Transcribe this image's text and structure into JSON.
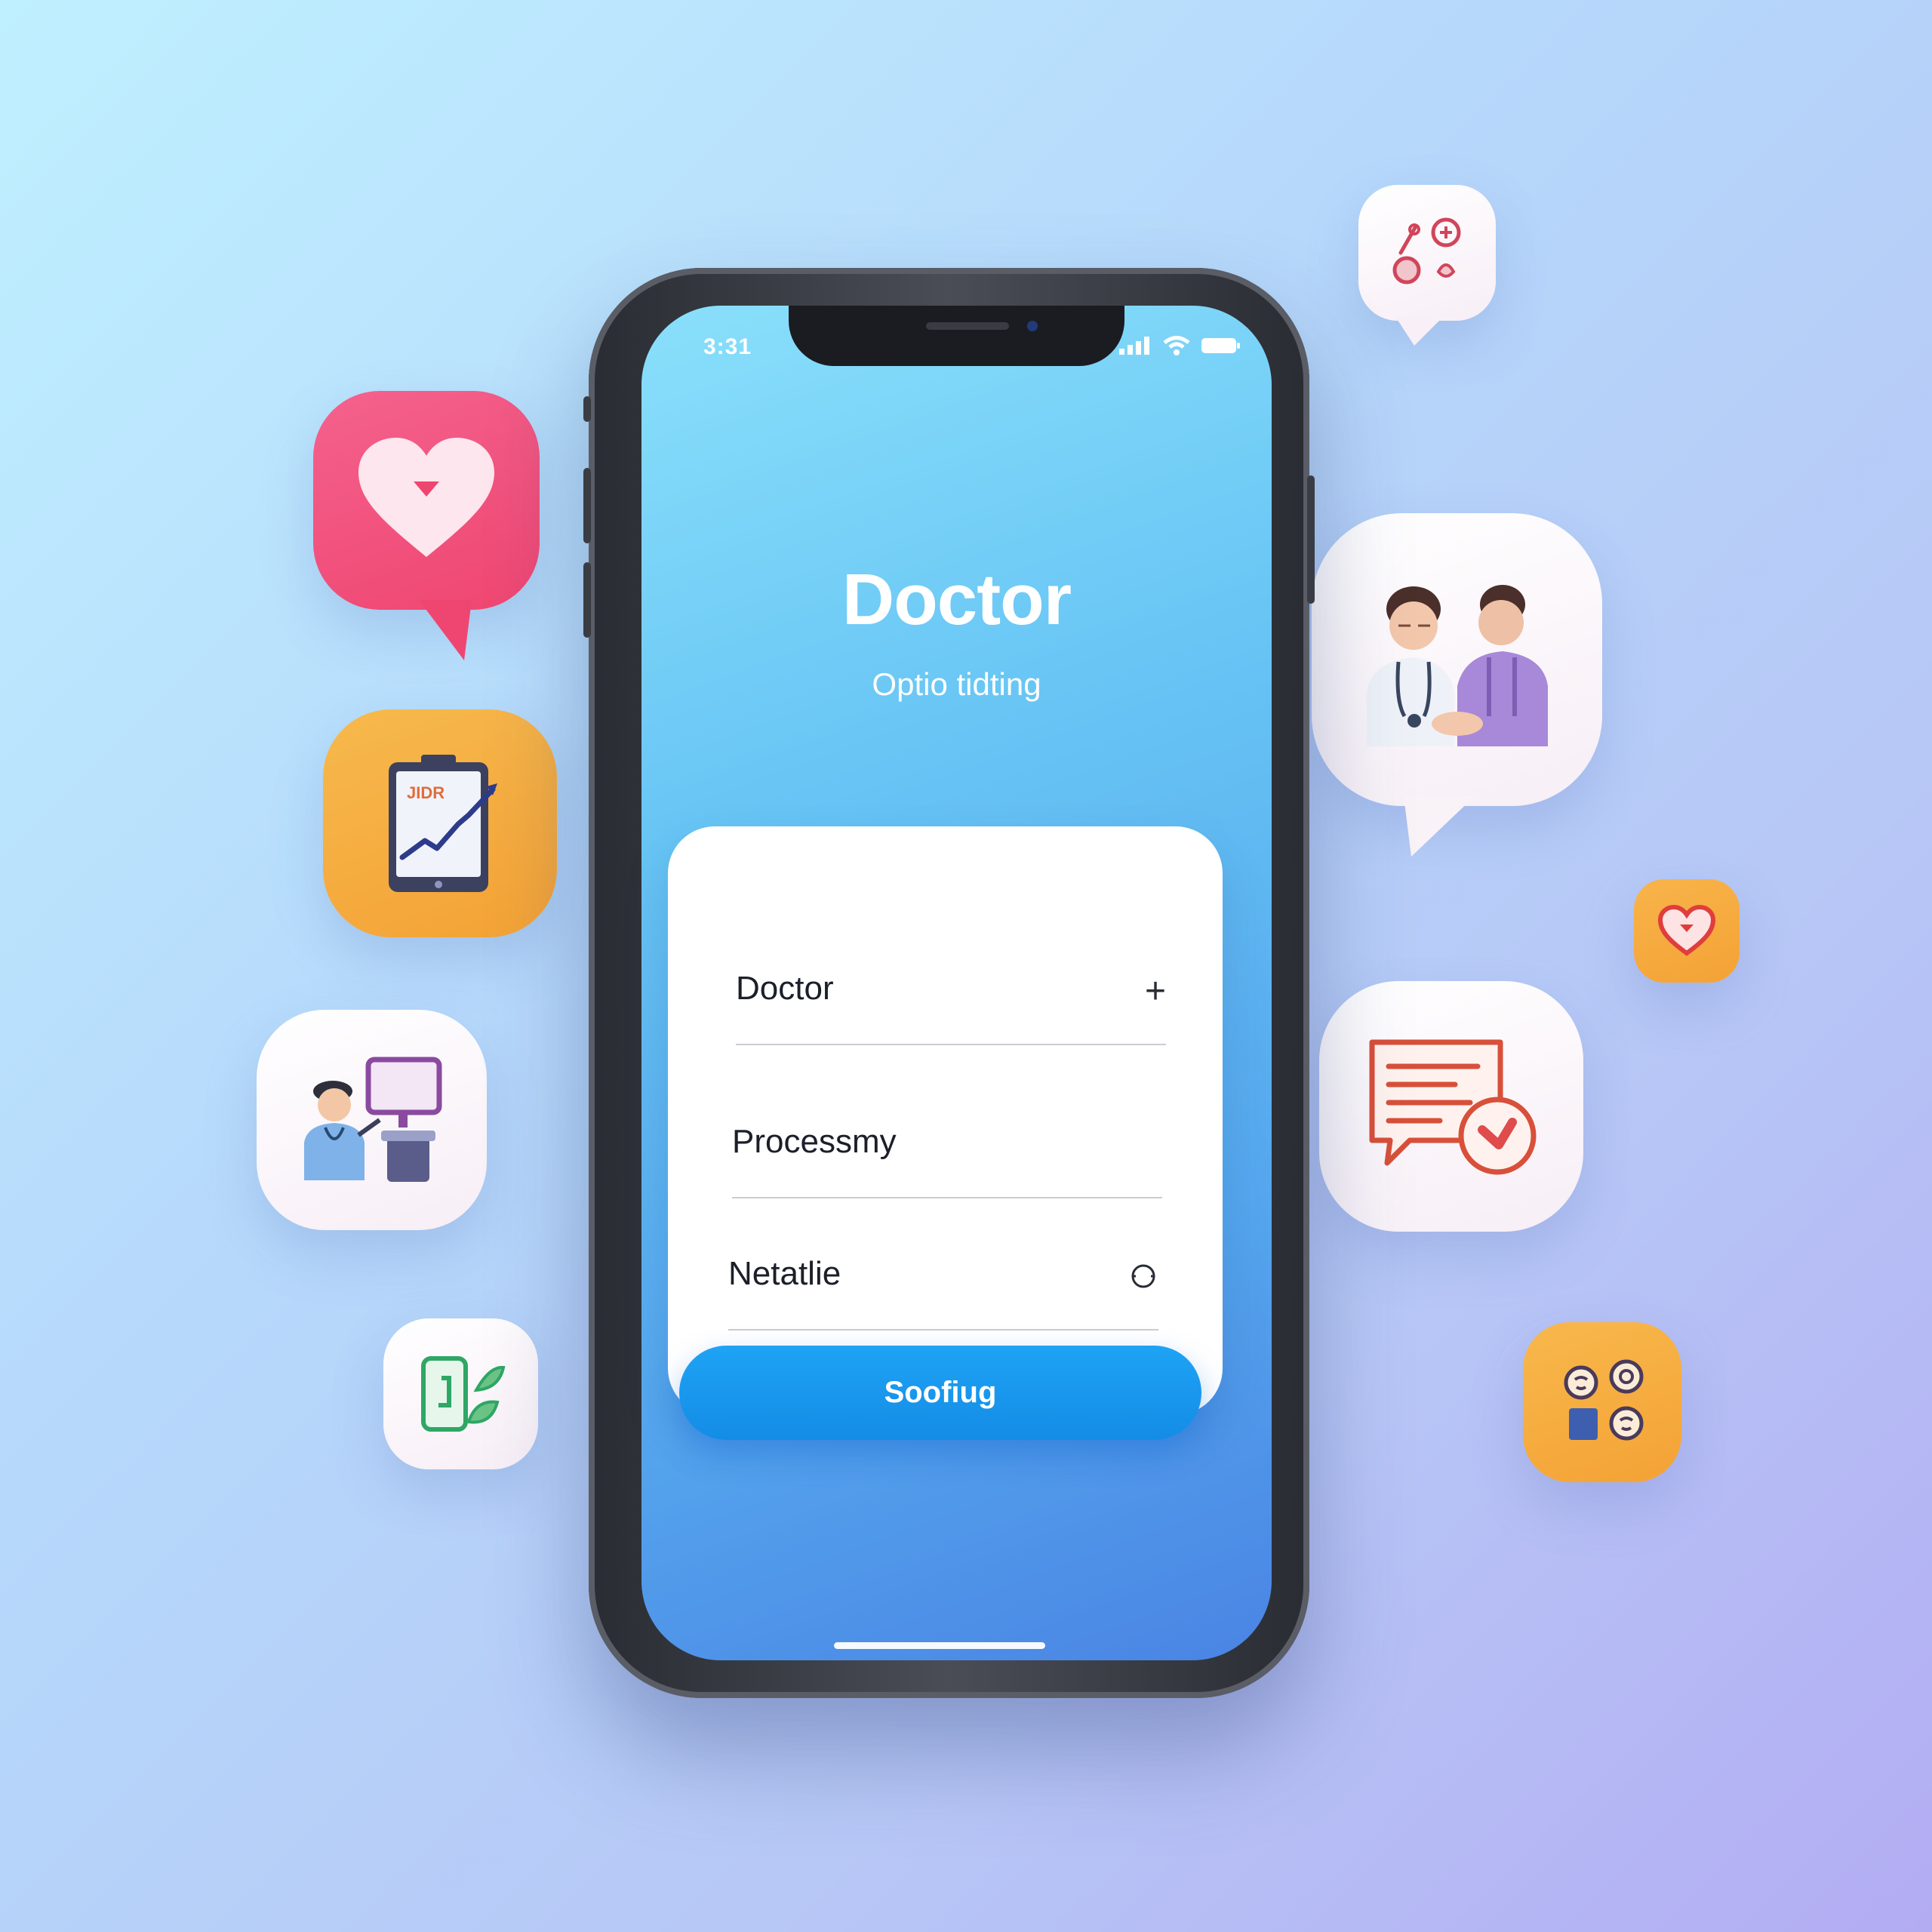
{
  "phone": {
    "status_time": "3:31",
    "title": "Doctor",
    "subtitle": "Optio tidting",
    "list": [
      {
        "label": "Doctor",
        "icon": "plus-icon"
      },
      {
        "label": "Processmy",
        "icon": ""
      },
      {
        "label": "Netatlie",
        "icon": "circle-icon"
      }
    ],
    "cta_label": "Soofiug"
  },
  "tiles": {
    "chart_screen_text": "JIDR"
  },
  "colors": {
    "accent_blue": "#148ce6",
    "heart_pink": "#f2537f",
    "tile_orange": "#f6ad3e"
  }
}
